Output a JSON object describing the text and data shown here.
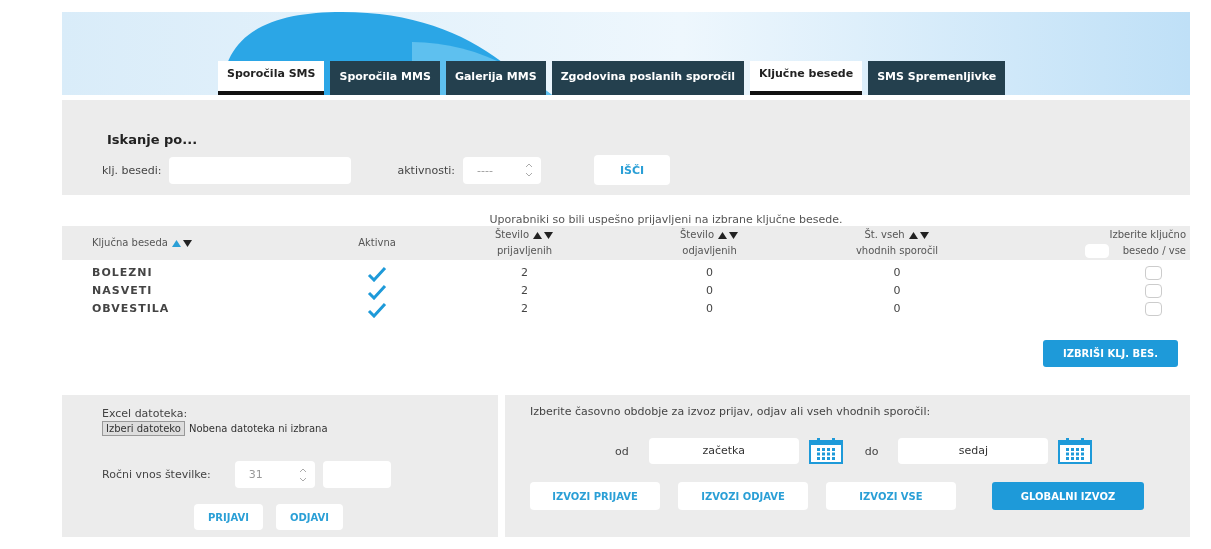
{
  "tabs": [
    {
      "label": "Sporočila SMS",
      "selected": true
    },
    {
      "label": "Sporočila MMS",
      "selected": false
    },
    {
      "label": "Galerija MMS",
      "selected": false
    },
    {
      "label": "Zgodovina poslanih sporočil",
      "selected": false
    },
    {
      "label": "Ključne besede",
      "selected": true
    },
    {
      "label": "SMS Spremenljivke",
      "selected": false
    }
  ],
  "search": {
    "title": "Iskanje po...",
    "keyword_label": "klj. besedi:",
    "activity_label": "aktivnosti:",
    "activity_value": "----",
    "button": "IŠČI"
  },
  "message": "Uporabniki so bili uspešno prijavljeni na izbrane ključne besede.",
  "table": {
    "columns": [
      {
        "line1": "Ključna beseda",
        "sorted": true
      },
      {
        "line1": "Aktivna"
      },
      {
        "line1": "Število",
        "line2": "prijavljenih",
        "sorted": false
      },
      {
        "line1": "Število",
        "line2": "odjavljenih",
        "sorted": false
      },
      {
        "line1": "Št. vseh",
        "line2": "vhodnih sporočil",
        "sorted": false
      },
      {
        "line1": "Izberite ključno",
        "line2": "besedo / vse",
        "select_all_checked": false
      }
    ],
    "rows": [
      {
        "keyword": "BOLEZNI",
        "active": true,
        "subscribed": "2",
        "unsubscribed": "0",
        "incoming": "0",
        "checked": false
      },
      {
        "keyword": "NASVETI",
        "active": true,
        "subscribed": "2",
        "unsubscribed": "0",
        "incoming": "0",
        "checked": false
      },
      {
        "keyword": "OBVESTILA",
        "active": true,
        "subscribed": "2",
        "unsubscribed": "0",
        "incoming": "0",
        "checked": false
      }
    ],
    "delete_button": "IZBRIŠI KLJ. BES."
  },
  "import": {
    "file_label": "Excel datoteka:",
    "file_button": "Izberi datoteko",
    "file_status": "Nobena datoteka ni izbrana",
    "manual_label": "Ročni vnos številke:",
    "number_value": "31",
    "buttons": [
      "PRIJAVI",
      "ODJAVI"
    ]
  },
  "export": {
    "title": "Izberite časovno obdobje za izvoz prijav, odjav ali vseh vhodnih sporočil:",
    "from_label": "od",
    "from_value": "začetka",
    "to_label": "do",
    "to_value": "sedaj",
    "buttons": [
      {
        "label": "IZVOZI PRIJAVE",
        "primary": false
      },
      {
        "label": "IZVOZI ODJAVE",
        "primary": false
      },
      {
        "label": "IZVOZI VSE",
        "primary": false
      },
      {
        "label": "GLOBALNI IZVOZ",
        "primary": true
      }
    ]
  }
}
